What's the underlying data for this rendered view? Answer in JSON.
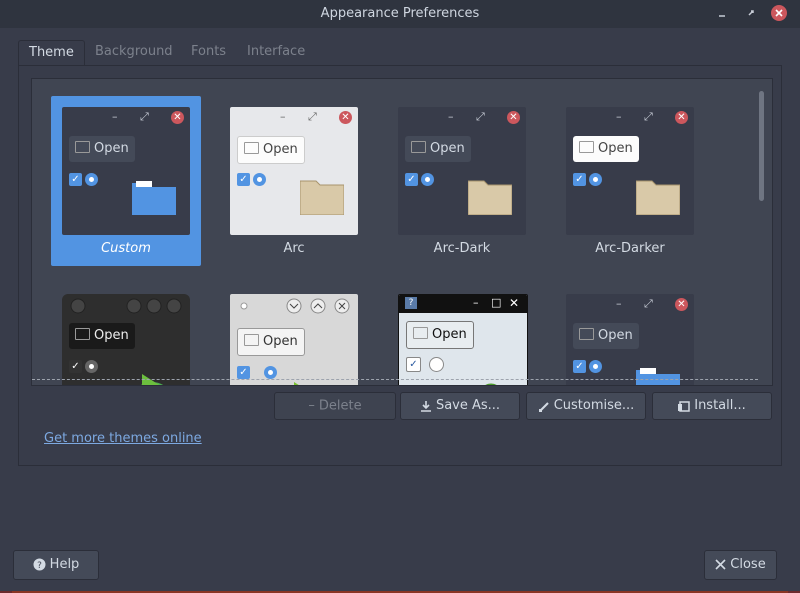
{
  "window": {
    "title": "Appearance Preferences",
    "controls": [
      "minimize-icon",
      "maximize-icon",
      "close-icon"
    ]
  },
  "tabs": [
    {
      "label": "Theme",
      "active": true
    },
    {
      "label": "Background",
      "active": false
    },
    {
      "label": "Fonts",
      "active": false
    },
    {
      "label": "Interface",
      "active": false
    }
  ],
  "themes": [
    {
      "name": "Custom",
      "selected": true,
      "preview_open": "Open"
    },
    {
      "name": "Arc",
      "selected": false,
      "preview_open": "Open"
    },
    {
      "name": "Arc-Dark",
      "selected": false,
      "preview_open": "Open"
    },
    {
      "name": "Arc-Darker",
      "selected": false,
      "preview_open": "Open"
    },
    {
      "name": "",
      "selected": false,
      "preview_open": "Open"
    },
    {
      "name": "",
      "selected": false,
      "preview_open": "Open"
    },
    {
      "name": "",
      "selected": false,
      "preview_open": "Open"
    },
    {
      "name": "",
      "selected": false,
      "preview_open": "Open"
    }
  ],
  "actions": {
    "delete": "Delete",
    "save_as": "Save As...",
    "customise": "Customise...",
    "install": "Install..."
  },
  "link_more_themes": "Get more themes online",
  "footer": {
    "help": "Help",
    "close": "Close"
  },
  "colors": {
    "accent": "#5294e2",
    "window_bg": "#383c4a",
    "titlebar_bg": "#2f343f",
    "close_red": "#cc575d",
    "link": "#7da9e1"
  }
}
